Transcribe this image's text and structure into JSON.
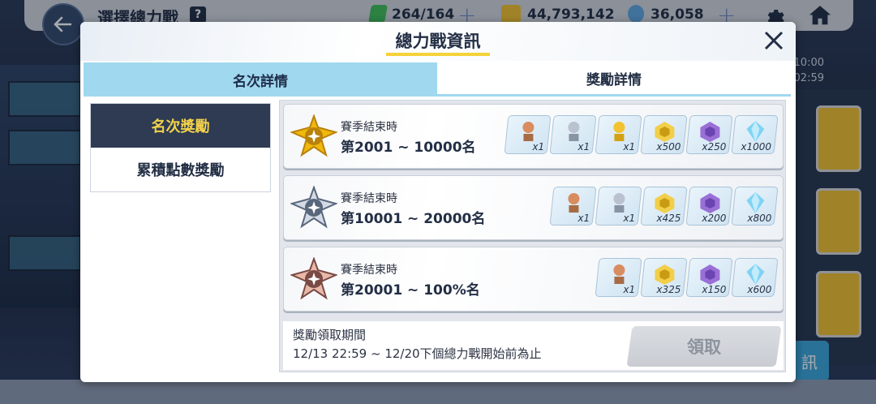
{
  "header": {
    "title": "選擇總力戰",
    "help_glyph": "?",
    "stamina": "264/164",
    "credits": "44,793,142",
    "gems": "36,058",
    "plus_glyph": "+"
  },
  "background": {
    "time_1": "10:00",
    "time_2": "02:59",
    "side_button": "訊"
  },
  "modal": {
    "title": "總力戰資訊",
    "tabs": [
      {
        "label": "名次詳情",
        "active": true
      },
      {
        "label": "獎勵詳情",
        "active": false
      }
    ],
    "side_menu": [
      {
        "label": "名次獎勵",
        "active": true
      },
      {
        "label": "累積點數獎勵",
        "active": false
      }
    ],
    "ranks": [
      {
        "line1": "賽季結束時",
        "line2": "第2001 ~ 10000名",
        "medal": "gold-medal",
        "rewards": [
          {
            "icon": "bronze-trophy-icon",
            "qty": "x1"
          },
          {
            "icon": "silver-trophy-icon",
            "qty": "x1"
          },
          {
            "icon": "gold-trophy-icon",
            "qty": "x1"
          },
          {
            "icon": "gold-chest-icon",
            "qty": "x500"
          },
          {
            "icon": "purple-chest-icon",
            "qty": "x250"
          },
          {
            "icon": "blue-crystal-icon",
            "qty": "x1000"
          }
        ]
      },
      {
        "line1": "賽季結束時",
        "line2": "第10001 ~ 20000名",
        "medal": "silver-medal",
        "rewards": [
          {
            "icon": "bronze-trophy-icon",
            "qty": "x1"
          },
          {
            "icon": "silver-trophy-icon",
            "qty": "x1"
          },
          {
            "icon": "gold-chest-icon",
            "qty": "x425"
          },
          {
            "icon": "purple-chest-icon",
            "qty": "x200"
          },
          {
            "icon": "blue-crystal-icon",
            "qty": "x800"
          }
        ]
      },
      {
        "line1": "賽季結束時",
        "line2": "第20001 ~ 100%名",
        "medal": "bronze-medal",
        "rewards": [
          {
            "icon": "bronze-trophy-icon",
            "qty": "x1"
          },
          {
            "icon": "gold-chest-icon",
            "qty": "x325"
          },
          {
            "icon": "purple-chest-icon",
            "qty": "x150"
          },
          {
            "icon": "blue-crystal-icon",
            "qty": "x600"
          }
        ]
      }
    ],
    "claim_label": "獎勵領取期間",
    "claim_period": "12/13 22:59 ~ 12/20下個總力戰開始前為止",
    "claim_button": "領取"
  },
  "colors": {
    "tab_active": "#9fd8ef",
    "side_active_bg": "#2e3b52",
    "side_active_text": "#f2d14b",
    "title_underline": "#f5d23a"
  }
}
